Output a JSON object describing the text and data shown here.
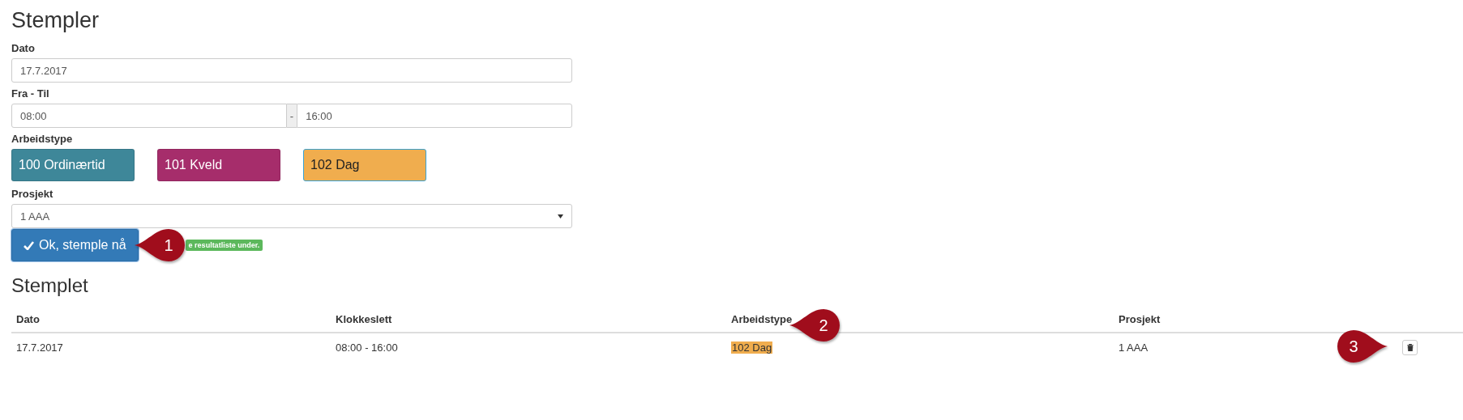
{
  "form": {
    "title": "Stempler",
    "date": {
      "label": "Dato",
      "value": "17.7.2017"
    },
    "time": {
      "label": "Fra - Til",
      "from": "08:00",
      "separator": "-",
      "to": "16:00"
    },
    "worktype": {
      "label": "Arbeidstype",
      "options": [
        {
          "label": "100 Ordinærtid",
          "color": "#3e8799",
          "selected": false
        },
        {
          "label": "101 Kveld",
          "color": "#a62d6b",
          "selected": false
        },
        {
          "label": "102 Dag",
          "color": "#f0ad4e",
          "selected": true
        }
      ]
    },
    "project": {
      "label": "Prosjekt",
      "value": "1 AAA"
    },
    "submit": "Ok, stemple nå",
    "notice": "e resultatliste under."
  },
  "table": {
    "title": "Stemplet",
    "columns": [
      "Dato",
      "Klokkeslett",
      "Arbeidstype",
      "Prosjekt"
    ],
    "rows": [
      {
        "date": "17.7.2017",
        "time": "08:00 - 16:00",
        "worktype": "102 Dag",
        "color": "#f0ad4e",
        "project": "1 AAA"
      }
    ]
  },
  "callouts": [
    {
      "number": "1",
      "kind": "left"
    },
    {
      "number": "2",
      "kind": "left"
    },
    {
      "number": "3",
      "kind": "right"
    }
  ]
}
